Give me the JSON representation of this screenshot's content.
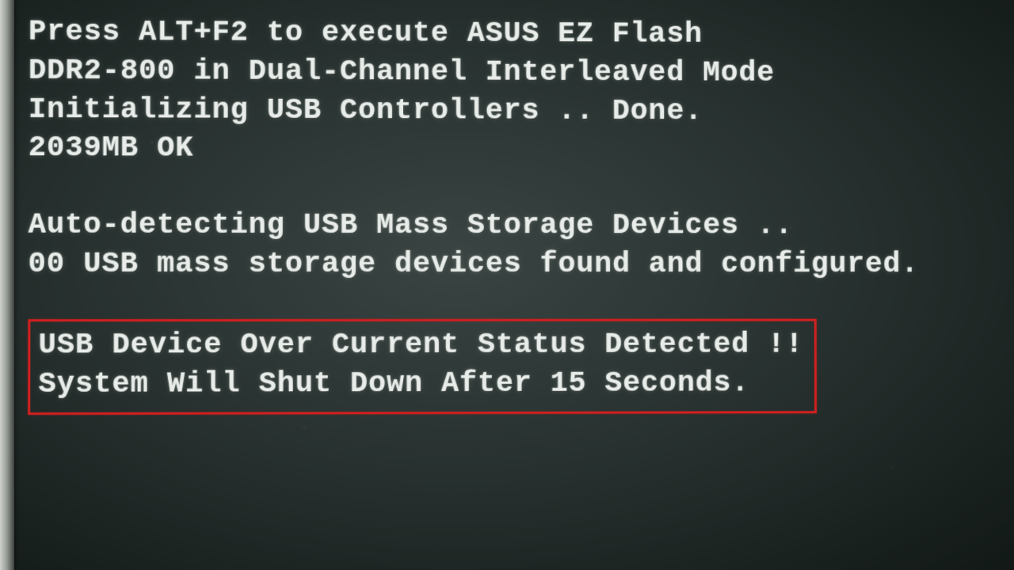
{
  "bios": {
    "lines": {
      "ez_flash": "Press ALT+F2 to execute ASUS EZ Flash",
      "memory_mode": "DDR2-800 in Dual-Channel Interleaved Mode",
      "usb_init": "Initializing USB Controllers .. Done.",
      "mem_check": "2039MB OK",
      "usb_detect": "Auto-detecting USB Mass Storage Devices ..",
      "usb_found": "00 USB mass storage devices found and configured.",
      "error_1": "USB Device Over Current Status Detected !!",
      "error_2": "System Will Shut Down After 15 Seconds."
    }
  },
  "highlight_color": "#d21f1f"
}
